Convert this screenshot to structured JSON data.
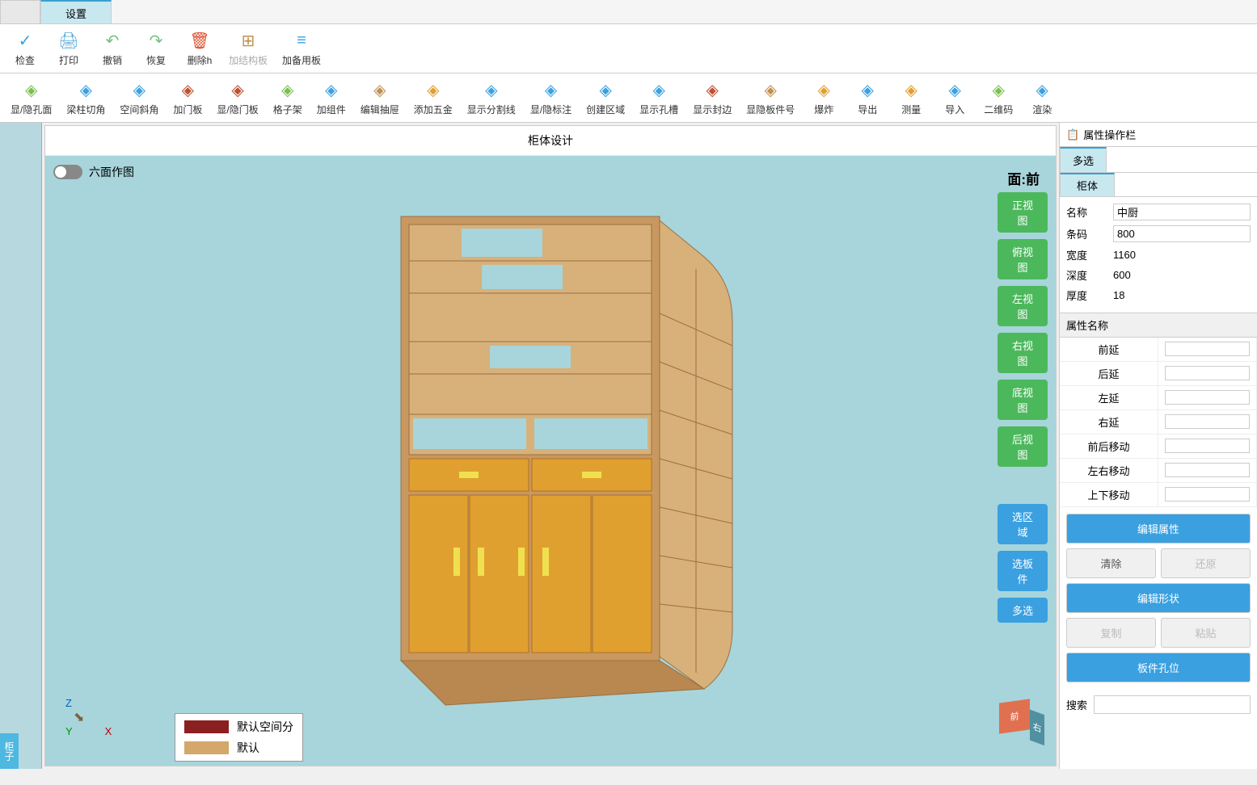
{
  "menu": {
    "settings": "设置"
  },
  "toolbar1": [
    {
      "label": "检查",
      "icon": "check",
      "color": "#3aa0e0"
    },
    {
      "label": "打印",
      "icon": "print",
      "color": "#5aa8d8"
    },
    {
      "label": "撤销",
      "icon": "undo",
      "color": "#7ac080"
    },
    {
      "label": "恢复",
      "icon": "redo",
      "color": "#7ac080"
    },
    {
      "label": "删除h",
      "icon": "trash",
      "color": "#e05030"
    },
    {
      "label": "加结构板",
      "icon": "grid",
      "color": "#c09050",
      "disabled": true
    },
    {
      "label": "加备用板",
      "icon": "stack",
      "color": "#3aa0e0"
    }
  ],
  "toolbar2": [
    {
      "label": "显/隐孔面",
      "color": "#7ac050"
    },
    {
      "label": "梁柱切角",
      "color": "#3aa0e0"
    },
    {
      "label": "空间斜角",
      "color": "#3aa0e0"
    },
    {
      "label": "加门板",
      "color": "#c05030"
    },
    {
      "label": "显/隐门板",
      "color": "#c05030"
    },
    {
      "label": "格子架",
      "color": "#7ac050"
    },
    {
      "label": "加组件",
      "color": "#3aa0e0"
    },
    {
      "label": "编辑抽屉",
      "color": "#c09050"
    },
    {
      "label": "添加五金",
      "color": "#e0a030"
    },
    {
      "label": "显示分割线",
      "color": "#3aa0e0"
    },
    {
      "label": "显/隐标注",
      "color": "#3aa0e0"
    },
    {
      "label": "创建区域",
      "color": "#3aa0e0"
    },
    {
      "label": "显示孔槽",
      "color": "#3aa0e0"
    },
    {
      "label": "显示封边",
      "color": "#c05030"
    },
    {
      "label": "显隐板件号",
      "color": "#c09050"
    },
    {
      "label": "爆炸",
      "color": "#e0a030"
    },
    {
      "label": "导出",
      "color": "#3aa0e0"
    },
    {
      "label": "测量",
      "color": "#e0a030"
    },
    {
      "label": "导入",
      "color": "#3aa0e0"
    },
    {
      "label": "二维码",
      "color": "#7ac050"
    },
    {
      "label": "渲染",
      "color": "#3aa0e0"
    }
  ],
  "viewport": {
    "title": "柜体设计",
    "toggle_label": "六面作图",
    "face_label": "面:前",
    "views": [
      "正视图",
      "俯视图",
      "左视图",
      "右视图",
      "底视图",
      "后视图"
    ],
    "select_buttons": [
      "选区域",
      "选板件",
      "多选"
    ],
    "axes": {
      "z": "Z",
      "y": "Y",
      "x": "X"
    },
    "cube": {
      "front": "前",
      "side": "右"
    },
    "legend": [
      {
        "color": "#8b2020",
        "label": "默认空间分"
      },
      {
        "color": "#d4a76a",
        "label": "默认"
      }
    ]
  },
  "left_sidebar": {
    "tab": "柜子"
  },
  "right_panel": {
    "header": "属性操作栏",
    "tab_multi": "多选",
    "tab_cabinet": "柜体",
    "props": {
      "name": {
        "label": "名称",
        "value": "中厨"
      },
      "barcode": {
        "label": "条码",
        "value": "800"
      },
      "width": {
        "label": "宽度",
        "value": "1160"
      },
      "depth": {
        "label": "深度",
        "value": "600"
      },
      "thickness": {
        "label": "厚度",
        "value": "18"
      }
    },
    "attr_header": "属性名称",
    "attrs": [
      "前延",
      "后延",
      "左延",
      "右延",
      "前后移动",
      "左右移动",
      "上下移动"
    ],
    "buttons": {
      "edit_attr": "编辑属性",
      "clear": "清除",
      "restore": "还原",
      "edit_shape": "编辑形状",
      "copy": "复制",
      "paste": "粘贴",
      "hole_pos": "板件孔位"
    },
    "search_label": "搜索"
  }
}
